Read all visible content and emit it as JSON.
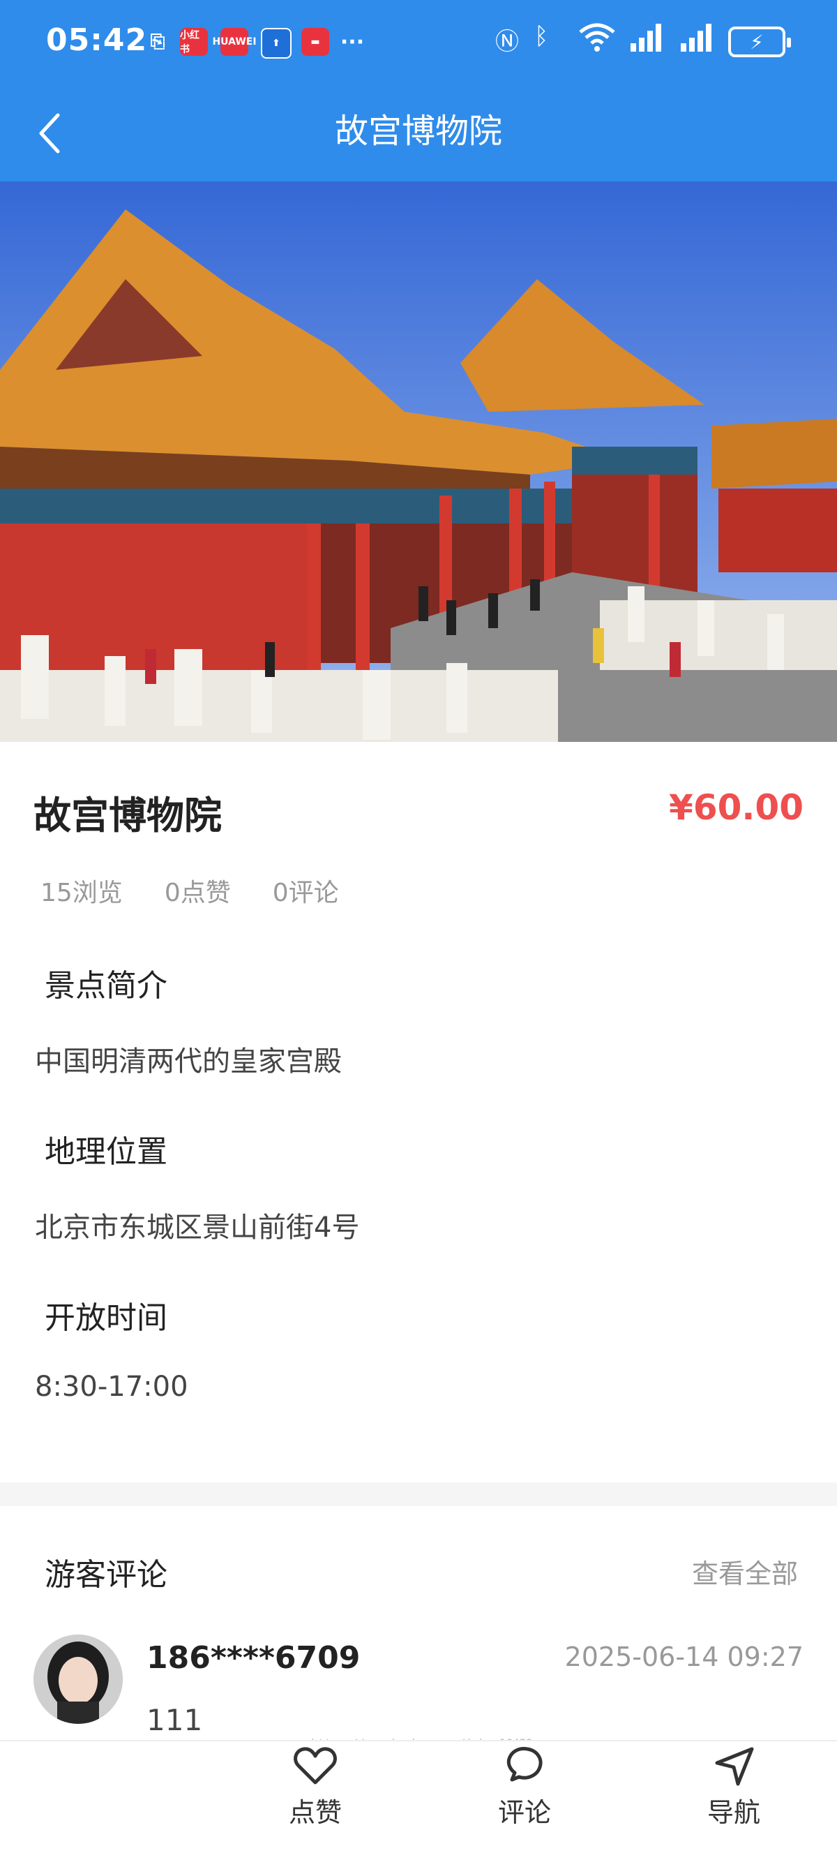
{
  "status_bar": {
    "time": "05:42",
    "notif_red1": "小红书",
    "notif_red2": "HUAWEI",
    "more": "···"
  },
  "header": {
    "title": "故宫博物院"
  },
  "attraction": {
    "name": "故宫博物院",
    "price": "¥60.00",
    "views": "15浏览",
    "likes": "0点赞",
    "comments": "0评论"
  },
  "sections": {
    "intro_title": "景点简介",
    "intro_text": "中国明清两代的皇家宫殿",
    "location_title": "地理位置",
    "location_text": "北京市东城区景山前街4号",
    "hours_title": "开放时间",
    "hours_text": "8:30-17:00"
  },
  "reviews": {
    "title": "游客评论",
    "view_all": "查看全部",
    "items": [
      {
        "user": "186****6709",
        "date": "2025-06-14 09:27",
        "text": "111"
      }
    ]
  },
  "watermark": "https://www.huzhan.com/ishop16453",
  "tabbar": {
    "like": "点赞",
    "comment": "评论",
    "navigate": "导航"
  },
  "colors": {
    "header_bg": "#2f8ceb",
    "price": "#ee4f4f"
  }
}
